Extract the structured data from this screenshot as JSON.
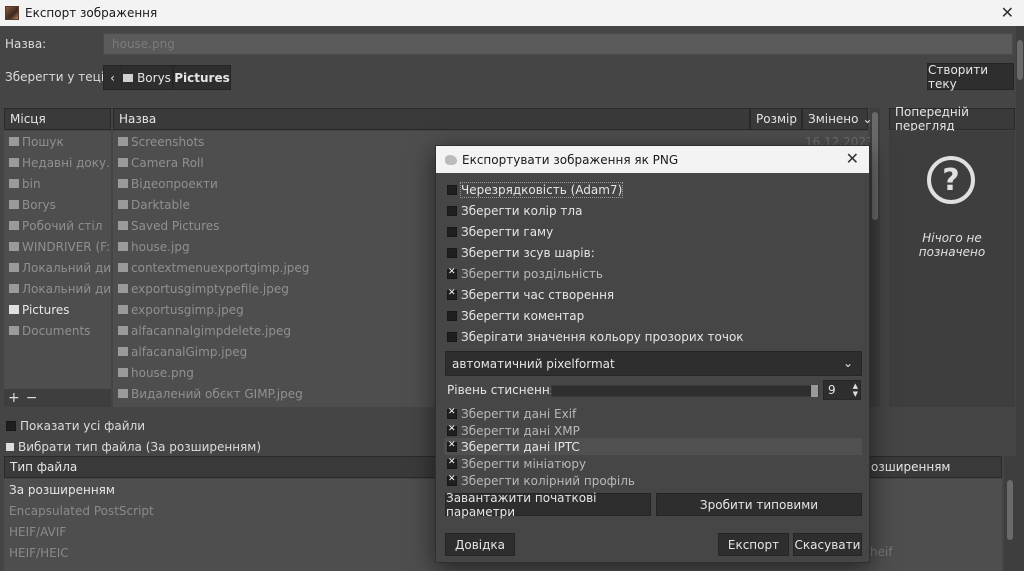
{
  "window": {
    "title": "Експорт зображення"
  },
  "name_row": {
    "label": "Назва:",
    "value": "house.png"
  },
  "save_in": {
    "label": "Зберегти у теці:",
    "path": [
      "Borys",
      "Pictures"
    ],
    "create_folder": "Створити теку"
  },
  "places": {
    "header": "Місця",
    "items": [
      {
        "label": "Пошук",
        "icon": "search-icon"
      },
      {
        "label": "Недавні доку…",
        "icon": "recent-icon"
      },
      {
        "label": "bin",
        "icon": "folder-icon"
      },
      {
        "label": "Borys",
        "icon": "folder-icon"
      },
      {
        "label": "Робочий стіл",
        "icon": "folder-icon"
      },
      {
        "label": "WINDRIVER (F:)",
        "icon": "drive-icon"
      },
      {
        "label": "Локальний ди…",
        "icon": "drive-icon"
      },
      {
        "label": "Локальний ди…",
        "icon": "drive-icon"
      },
      {
        "label": "Pictures",
        "icon": "folder-icon"
      },
      {
        "label": "Documents",
        "icon": "folder-icon"
      }
    ],
    "add": "+",
    "remove": "−"
  },
  "files": {
    "col_name": "Назва",
    "col_size": "Розмір",
    "col_modified": "Змінено",
    "first_date": "16.12.2023",
    "items": [
      "Screenshots",
      "Camera Roll",
      "Відеопроекти",
      "Darktable",
      "Saved Pictures",
      "house.jpg",
      "contextmenuexportgimp.jpeg",
      "exportusgimptypefile.jpeg",
      "exportusgimp.jpeg",
      "alfacannalgimpdelete.jpeg",
      "alfacanalGimp.jpeg",
      "house.png",
      "Видалений обєкт GIMP.jpeg"
    ]
  },
  "preview": {
    "header": "Попередній перегляд",
    "empty": "Нічого не позначено"
  },
  "show_all": "Показати усі файли",
  "file_type_toggle": "Вибрати тип файла (За розширенням)",
  "filetype": {
    "col_type": "Тип файла",
    "col_ext": "озширенням",
    "items": [
      "За розширенням",
      "Encapsulated PostScript",
      "HEIF/AVIF",
      "HEIF/HEIC"
    ],
    "right_hint": "heif"
  },
  "dialog": {
    "title": "Експортувати зображення як PNG",
    "options": [
      {
        "label": "Черезрядковість (Adam7)",
        "checked": false
      },
      {
        "label": "Зберегти колір тла",
        "checked": false
      },
      {
        "label": "Зберегти гаму",
        "checked": false
      },
      {
        "label": "Зберегти зсув шарів:",
        "checked": false
      },
      {
        "label": "Зберегти роздільність",
        "checked": true
      },
      {
        "label": "Зберегти час створення",
        "checked": true
      },
      {
        "label": "Зберегти коментар",
        "checked": false
      },
      {
        "label": "Зберігати значення кольору прозорих точок",
        "checked": false
      }
    ],
    "pixelformat": "автоматичний pixelformat",
    "compression_label": "Рівень стиснення:",
    "compression_value": "9",
    "compression_fraction": 0.98,
    "metadata": [
      {
        "label": "Зберегти дані Exif",
        "checked": true
      },
      {
        "label": "Зберегти дані XMP",
        "checked": true
      },
      {
        "label": "Зберегти дані IPTC",
        "checked": true
      },
      {
        "label": "Зберегти мініатюру",
        "checked": true
      },
      {
        "label": "Зберегти колірний профіль",
        "checked": true
      }
    ],
    "load_defaults": "Завантажити початкові параметри",
    "save_defaults": "Зробити типовими",
    "help": "Довідка",
    "export": "Експорт",
    "cancel": "Скасувати"
  }
}
